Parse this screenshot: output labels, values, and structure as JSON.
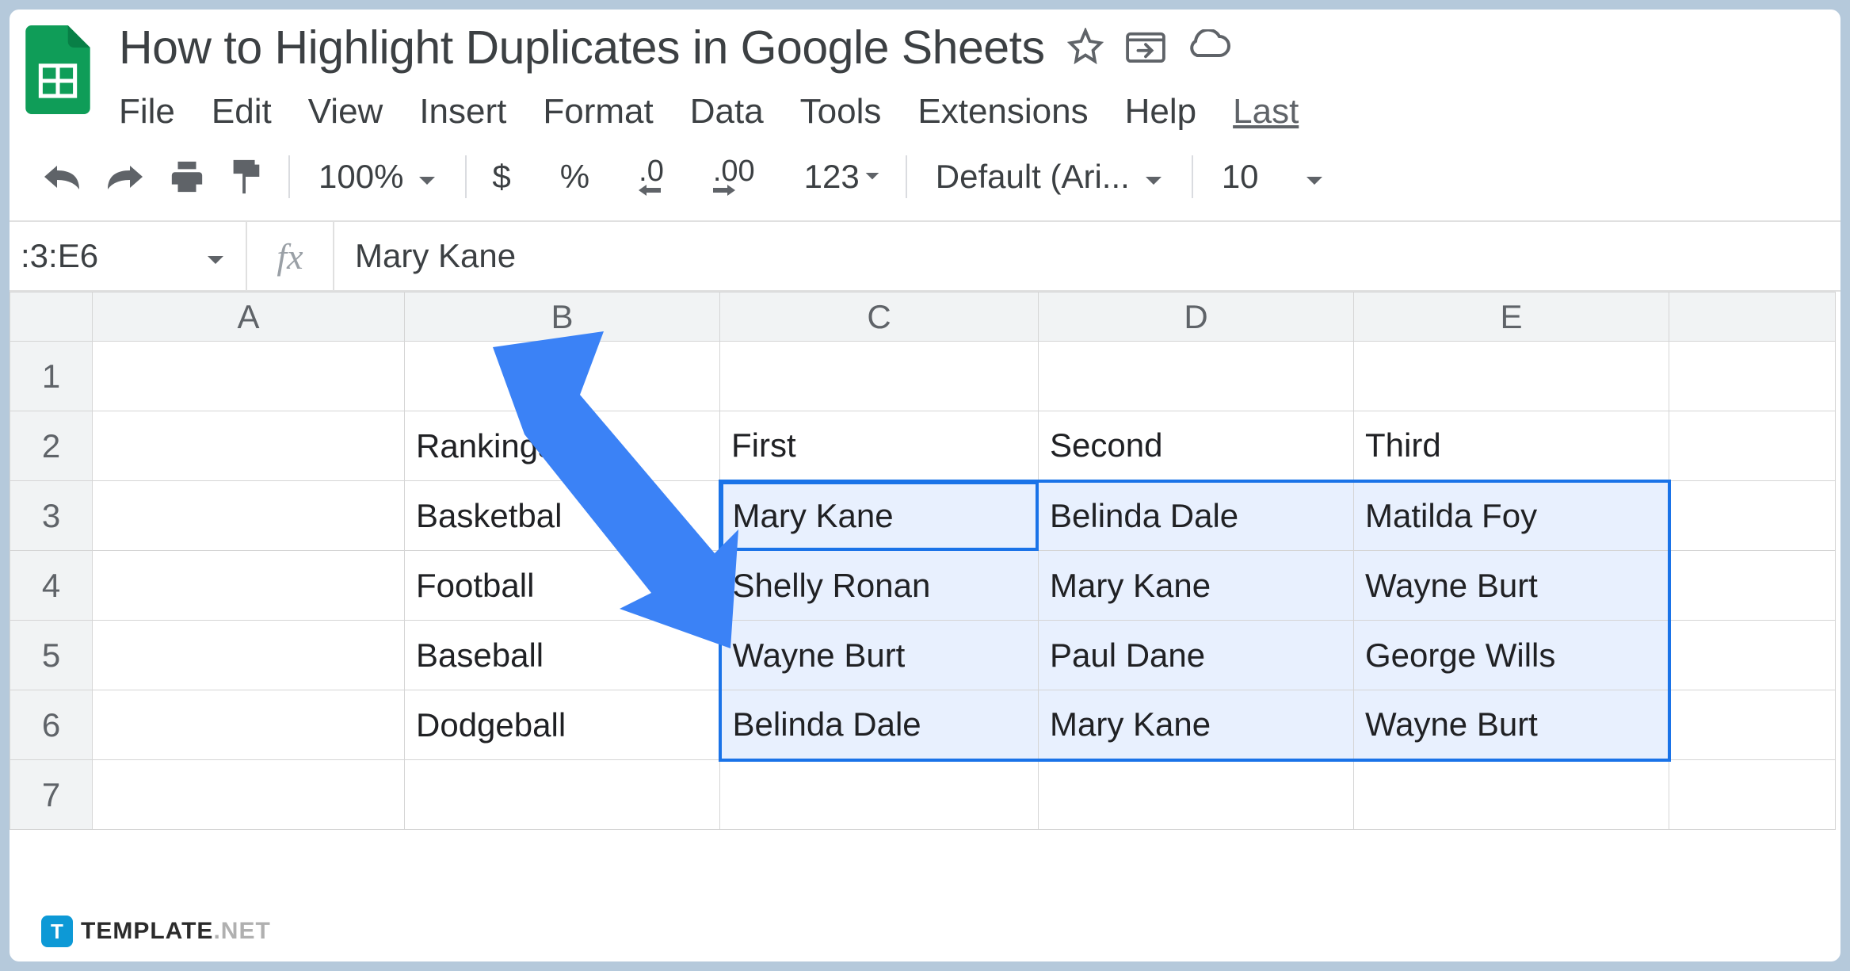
{
  "doc": {
    "title": "How to Highlight Duplicates in Google Sheets"
  },
  "menu": {
    "file": "File",
    "edit": "Edit",
    "view": "View",
    "insert": "Insert",
    "format": "Format",
    "data": "Data",
    "tools": "Tools",
    "extensions": "Extensions",
    "help": "Help",
    "last": "Last"
  },
  "toolbar": {
    "zoom": "100%",
    "currency": "$",
    "percent": "%",
    "dec_dec": ".0",
    "inc_dec": ".00",
    "more_formats": "123",
    "font": "Default (Ari...",
    "size": "10"
  },
  "namebox": {
    "range": ":3:E6",
    "fx_value": "Mary Kane"
  },
  "columns": [
    "A",
    "B",
    "C",
    "D",
    "E"
  ],
  "rows": [
    "1",
    "2",
    "3",
    "4",
    "5",
    "6",
    "7"
  ],
  "cells": {
    "B2": "Rankings",
    "C2": "First",
    "D2": "Second",
    "E2": "Third",
    "B3": "Basketbal",
    "C3": "Mary Kane",
    "D3": "Belinda Dale",
    "E3": "Matilda Foy",
    "B4": "Football",
    "C4": "Shelly Ronan",
    "D4": "Mary Kane",
    "E4": "Wayne Burt",
    "B5": "Baseball",
    "C5": "Wayne Burt",
    "D5": "Paul Dane",
    "E5": "George Wills",
    "B6": "Dodgeball",
    "C6": "Belinda Dale",
    "D6": "Mary Kane",
    "E6": "Wayne Burt"
  },
  "watermark": {
    "logo_letter": "T",
    "name_dark": "TEMPLATE",
    "name_light": ".NET"
  }
}
